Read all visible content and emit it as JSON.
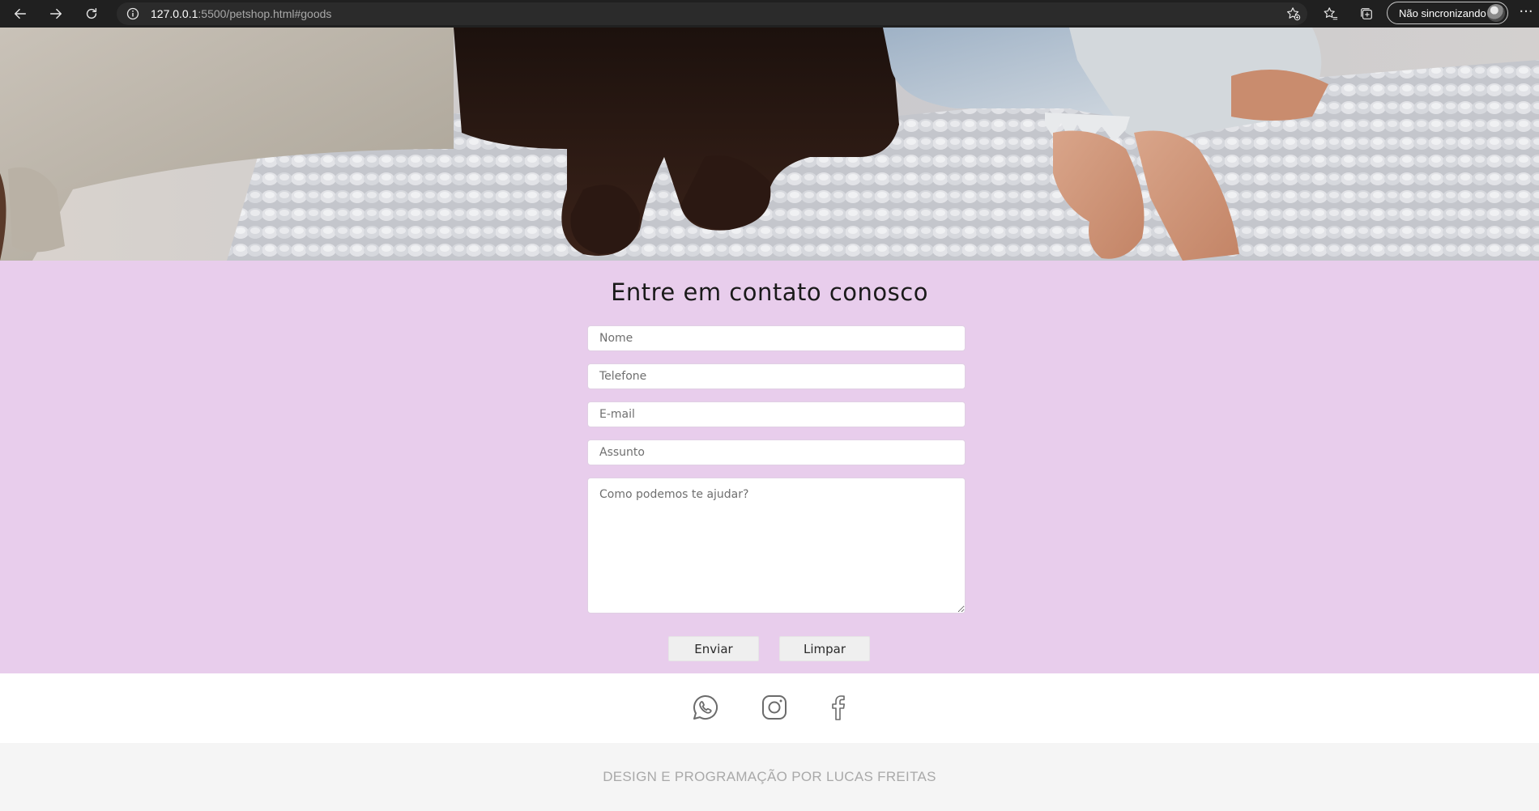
{
  "browser": {
    "url_host": "127.0.0.1",
    "url_rest": ":5500/petshop.html#goods",
    "profile_label": "Não sincronizando",
    "more_label": "···"
  },
  "contact": {
    "title": "Entre em contato conosco",
    "fields": {
      "name_placeholder": "Nome",
      "phone_placeholder": "Telefone",
      "email_placeholder": "E-mail",
      "subject_placeholder": "Assunto",
      "message_placeholder": "Como podemos te ajudar?"
    },
    "submit_label": "Enviar",
    "reset_label": "Limpar"
  },
  "social": {
    "icons": [
      "whatsapp-icon",
      "instagram-icon",
      "facebook-icon"
    ],
    "icon_color": "#6b6b6b"
  },
  "footer": {
    "credit": "DESIGN E PROGRAMAÇÃO POR LUCAS FREITAS"
  },
  "colors": {
    "contact_background": "#e8cdec",
    "footer_background": "#f5f5f5",
    "chrome_background": "#202020"
  }
}
